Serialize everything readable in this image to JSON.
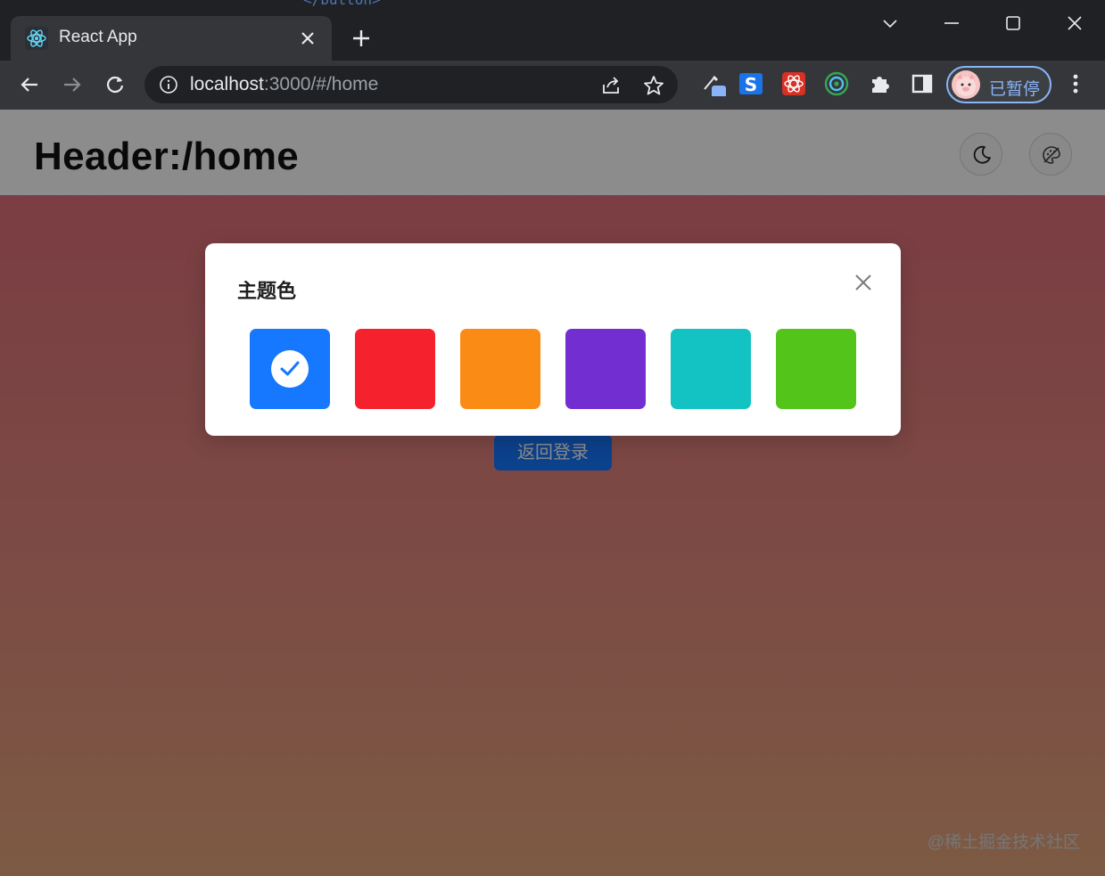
{
  "browser": {
    "tab_title": "React App",
    "url_host": "localhost",
    "url_rest": ":3000/#/home",
    "profile_label": "已暂停",
    "code_peek": "</button>",
    "icons": {
      "favicon": "react-icon",
      "tab_close": "close-icon",
      "new_tab": "plus-icon",
      "back": "arrow-left-icon",
      "forward": "arrow-right-icon",
      "reload": "reload-icon",
      "info": "info-icon",
      "share": "share-icon",
      "bookmark": "star-icon",
      "extensions": "puzzle-icon",
      "sidepanel": "side-panel-icon",
      "menu": "kebab-menu-icon"
    }
  },
  "header": {
    "title": "Header:/home",
    "dark_mode_icon": "moon-icon",
    "theme_icon": "palette-off-icon"
  },
  "content": {
    "login_button": "返回登录",
    "watermark": "@稀土掘金技术社区"
  },
  "modal": {
    "title": "主题色",
    "close_icon": "close-icon",
    "selected_index": 0,
    "swatches": [
      {
        "color": "#1677ff"
      },
      {
        "color": "#f5222d"
      },
      {
        "color": "#fa8c16"
      },
      {
        "color": "#722ed1"
      },
      {
        "color": "#13c2c2"
      },
      {
        "color": "#52c41a"
      }
    ]
  }
}
